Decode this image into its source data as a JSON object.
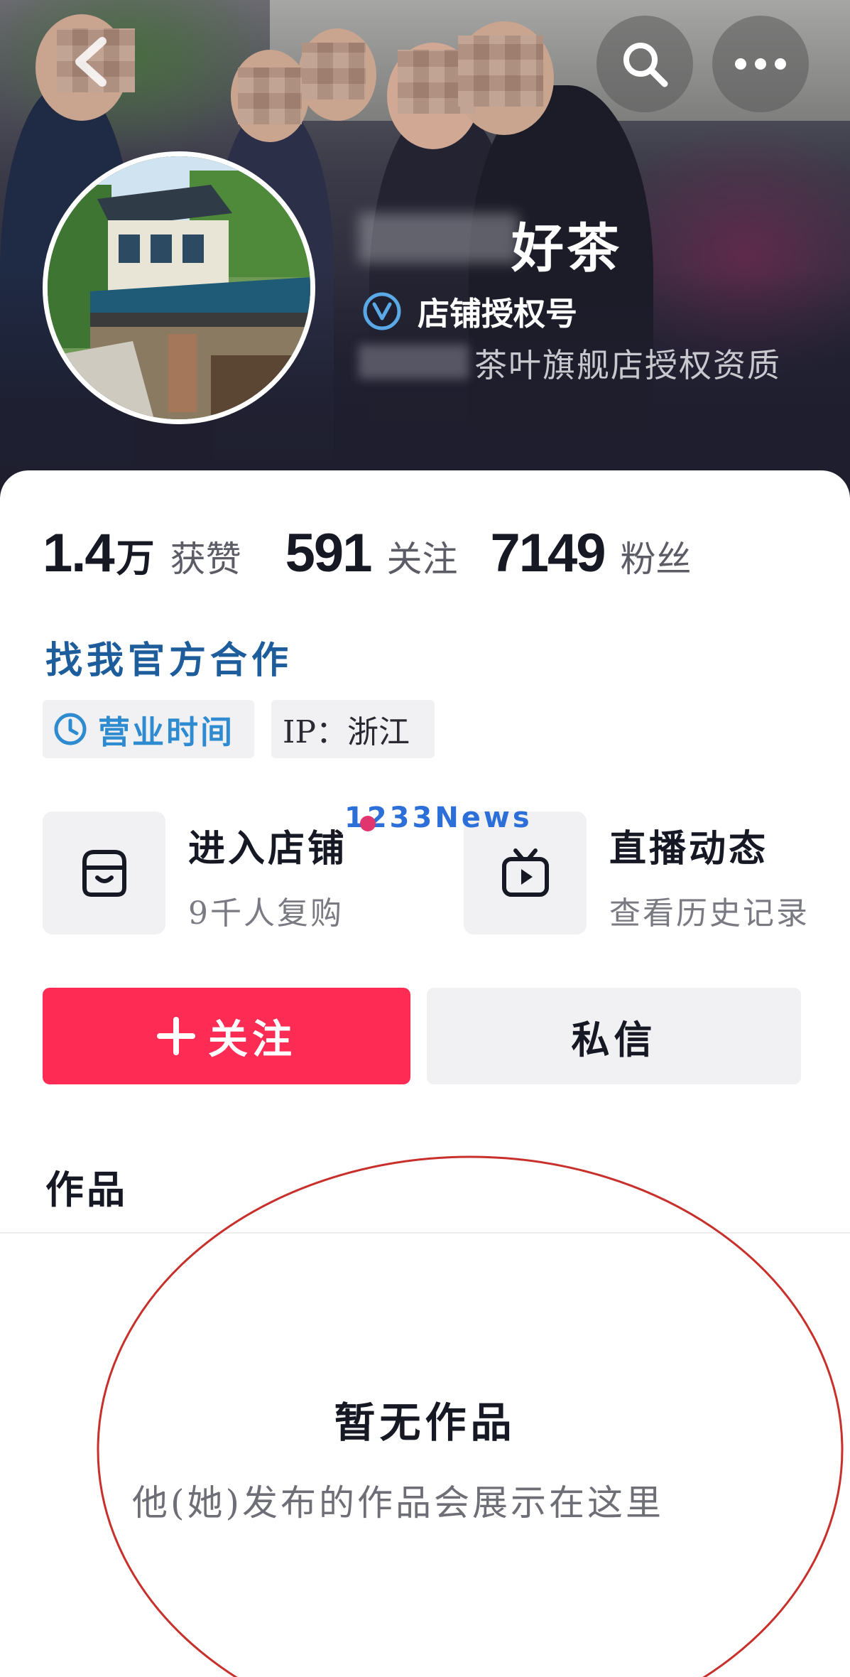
{
  "header": {
    "shop_name": "好茶",
    "verify_label": "店铺授权号",
    "authorization_line": "茶叶旗舰店授权资质"
  },
  "stats": {
    "likes_value": "1.4",
    "likes_unit": "万",
    "likes_label": "获赞",
    "following_value": "591",
    "following_label": "关注",
    "followers_value": "7149",
    "followers_label": "粉丝"
  },
  "profile": {
    "cooperation_link": "找我官方合作",
    "business_hours_label": "营业时间",
    "ip_label": "IP：浙江"
  },
  "entries": {
    "shop_title": "进入店铺",
    "shop_subtitle": "9千人复购",
    "live_title": "直播动态",
    "live_subtitle": "查看历史记录"
  },
  "actions": {
    "follow_icon": "+",
    "follow_label": "关注",
    "message_label": "私信"
  },
  "tabs": {
    "works_label": "作品"
  },
  "empty_state": {
    "title": "暂无作品",
    "subtitle": "他(她)发布的作品会展示在这里"
  },
  "watermark": {
    "text": "1233News"
  },
  "icons": {
    "back": "chevron-left-icon",
    "search": "search-icon",
    "more": "more-dots-icon",
    "verified": "verified-v-icon",
    "clock": "clock-icon",
    "shop": "shop-icon",
    "live": "tv-play-icon"
  },
  "colors": {
    "follow_button": "#fe2c55",
    "link_blue": "#1d5d9c",
    "hours_blue": "#2f8bd0",
    "annotation_red": "#c8302b",
    "banner_dark": "#1e1e2e"
  }
}
